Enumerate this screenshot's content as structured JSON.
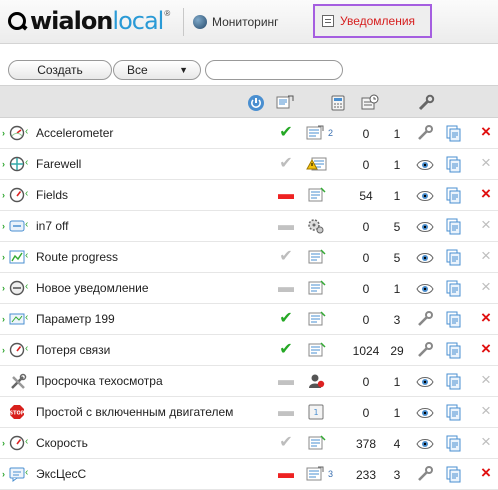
{
  "header": {
    "logo_part1": "wialon",
    "logo_part2": "local",
    "logo_tm": "®",
    "tabs": [
      {
        "label": "Мониторинг",
        "active": false
      },
      {
        "label": "Уведомления",
        "active": true
      }
    ]
  },
  "toolbar": {
    "create_label": "Создать",
    "filter_value": "Все",
    "search_value": "",
    "search_placeholder": ""
  },
  "colors": {
    "accent": "#d61e1e",
    "highlight_border": "#a55ee0",
    "ok_green": "#25a825",
    "delete_red": "#e01010",
    "link_blue": "#2a9ad6"
  },
  "table": {
    "header_icons": [
      "power-icon",
      "action-icon",
      "count-icon",
      "history-icon",
      "edit-icon"
    ],
    "rows": [
      {
        "name": "Accelerometer",
        "type_icon": "accelerometer-icon",
        "state": "enabled",
        "action_icon": "action-multi-icon",
        "action_count": "2",
        "triggered": "0",
        "units": "1",
        "edit": "wrench",
        "del": true
      },
      {
        "name": "Farewell",
        "type_icon": "geofence-icon",
        "state": "off",
        "action_icon": "warning-icon",
        "action_count": "",
        "triggered": "0",
        "units": "1",
        "edit": "eye",
        "del": false
      },
      {
        "name": "Fields",
        "type_icon": "speedometer-icon",
        "state": "error",
        "action_icon": "notepad-icon",
        "action_count": "",
        "triggered": "54",
        "units": "1",
        "edit": "eye",
        "del": true
      },
      {
        "name": "in7 off",
        "type_icon": "input-icon",
        "state": "disabled",
        "action_icon": "gears-icon",
        "action_count": "",
        "triggered": "0",
        "units": "5",
        "edit": "eye",
        "del": false
      },
      {
        "name": "Route progress",
        "type_icon": "route-icon",
        "state": "off",
        "action_icon": "notepad-icon",
        "action_count": "",
        "triggered": "0",
        "units": "5",
        "edit": "eye",
        "del": false
      },
      {
        "name": "Новое уведомление",
        "type_icon": "connection-icon",
        "state": "disabled",
        "action_icon": "notepad-icon",
        "action_count": "",
        "triggered": "0",
        "units": "1",
        "edit": "eye",
        "del": false
      },
      {
        "name": "Параметр 199",
        "type_icon": "parameter-icon",
        "state": "enabled",
        "action_icon": "notepad-icon",
        "action_count": "",
        "triggered": "0",
        "units": "3",
        "edit": "wrench",
        "del": true
      },
      {
        "name": "Потеря связи",
        "type_icon": "speedometer-icon",
        "state": "enabled",
        "action_icon": "notepad-icon",
        "action_count": "",
        "triggered": "1024",
        "units": "29",
        "edit": "wrench",
        "del": true
      },
      {
        "name": "Просрочка техосмотра",
        "type_icon": "maintenance-icon",
        "state": "disabled",
        "action_icon": "driver-icon",
        "action_count": "",
        "triggered": "0",
        "units": "1",
        "edit": "eye",
        "del": false
      },
      {
        "name": "Простой с включенным двигателем",
        "type_icon": "stop-icon",
        "state": "disabled",
        "action_icon": "counter-icon",
        "action_count": "",
        "triggered": "0",
        "units": "1",
        "edit": "eye",
        "del": false
      },
      {
        "name": "Скорость",
        "type_icon": "speedometer-icon",
        "state": "off",
        "action_icon": "notepad-icon",
        "action_count": "",
        "triggered": "378",
        "units": "4",
        "edit": "eye",
        "del": false
      },
      {
        "name": "ЭксЦесС",
        "type_icon": "message-icon",
        "state": "error",
        "action_icon": "action-multi-icon",
        "action_count": "3",
        "triggered": "233",
        "units": "3",
        "edit": "wrench",
        "del": true
      }
    ]
  }
}
